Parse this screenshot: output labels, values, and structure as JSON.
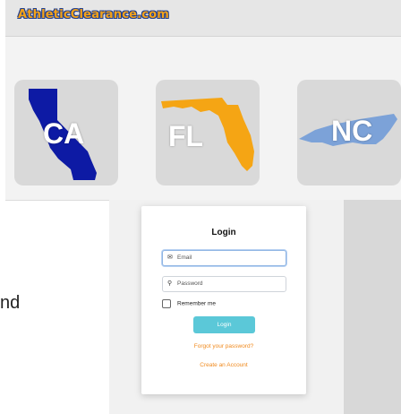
{
  "site": {
    "logo_text": "AthleticClearance.com"
  },
  "states": [
    {
      "abbr": "CA",
      "color": "#0d1aa4"
    },
    {
      "abbr": "FL",
      "color": "#f5a514"
    },
    {
      "abbr": "NC",
      "color": "#7ca2d8"
    }
  ],
  "partial_text": "nd",
  "login": {
    "title": "Login",
    "email_placeholder": "Email",
    "password_placeholder": "Password",
    "remember_label": "Remember me",
    "login_button": "Login",
    "forgot_link": "Forgot your password?",
    "create_link": "Create an Account"
  },
  "colors": {
    "accent": "#5bc8d8",
    "link": "#f08a1e"
  }
}
